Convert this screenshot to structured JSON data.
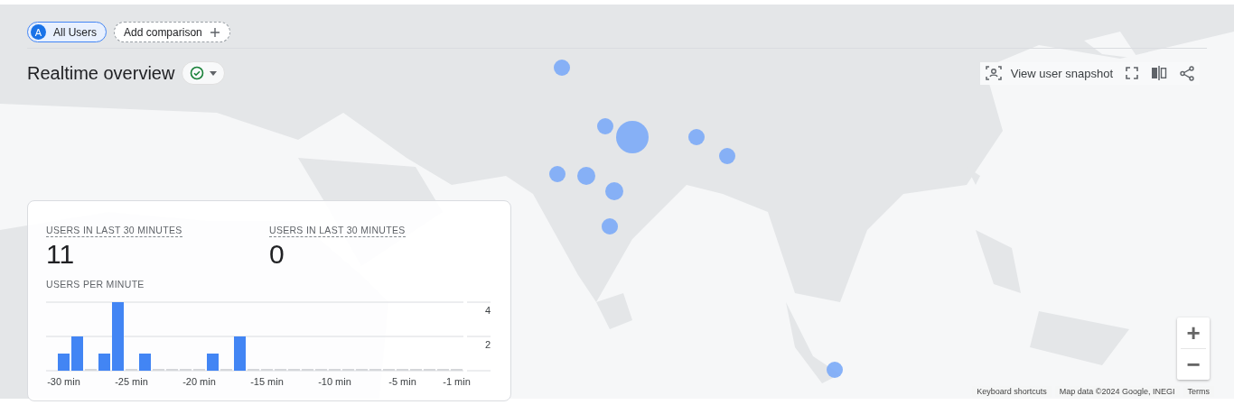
{
  "segments": [
    {
      "kind": "segment",
      "badge": "A",
      "label": "All Users",
      "selected": true
    },
    {
      "kind": "add",
      "label": "Add comparison",
      "selected": false
    }
  ],
  "title": "Realtime overview",
  "status": {
    "ok": true
  },
  "toolbar": {
    "snapshot": "View user snapshot"
  },
  "card": {
    "metrics": [
      {
        "label": "USERS IN LAST 30 MINUTES",
        "value": "11"
      },
      {
        "label": "USERS IN LAST 30 MINUTES",
        "value": "0"
      }
    ],
    "chart_title": "USERS PER MINUTE",
    "chart_data": {
      "type": "bar",
      "x": [
        -30,
        -29,
        -28,
        -27,
        -26,
        -25,
        -24,
        -23,
        -22,
        -21,
        -20,
        -19,
        -18,
        -17,
        -16,
        -15,
        -14,
        -13,
        -12,
        -11,
        -10,
        -9,
        -8,
        -7,
        -6,
        -5,
        -4,
        -3,
        -2,
        -1
      ],
      "xlim": [
        -30.5,
        -0.5
      ],
      "series": [
        {
          "color": "#4285f4",
          "values": [
            1,
            2,
            0,
            1,
            4,
            0,
            1,
            0,
            0,
            0,
            0,
            1,
            0,
            2,
            0,
            0,
            0,
            0,
            0,
            0,
            0,
            0,
            0,
            0,
            0,
            0,
            0,
            0,
            0,
            0
          ]
        }
      ],
      "xticks": [
        {
          "value": -30,
          "label": "-30 min"
        },
        {
          "value": -25,
          "label": "-25 min"
        },
        {
          "value": -20,
          "label": "-20 min"
        },
        {
          "value": -15,
          "label": "-15 min"
        },
        {
          "value": -10,
          "label": "-10 min"
        },
        {
          "value": -5,
          "label": "-5 min"
        },
        {
          "value": -1,
          "label": "-1 min"
        }
      ],
      "yticks": [
        {
          "value": 2,
          "label": "2"
        },
        {
          "value": 4,
          "label": "4"
        }
      ],
      "ylim": [
        0,
        4
      ]
    }
  },
  "zoom": {
    "in": "+",
    "out": "−"
  },
  "attribution": [
    "Keyboard shortcuts",
    "Map data ©2024 Google, INEGI",
    "Terms"
  ]
}
